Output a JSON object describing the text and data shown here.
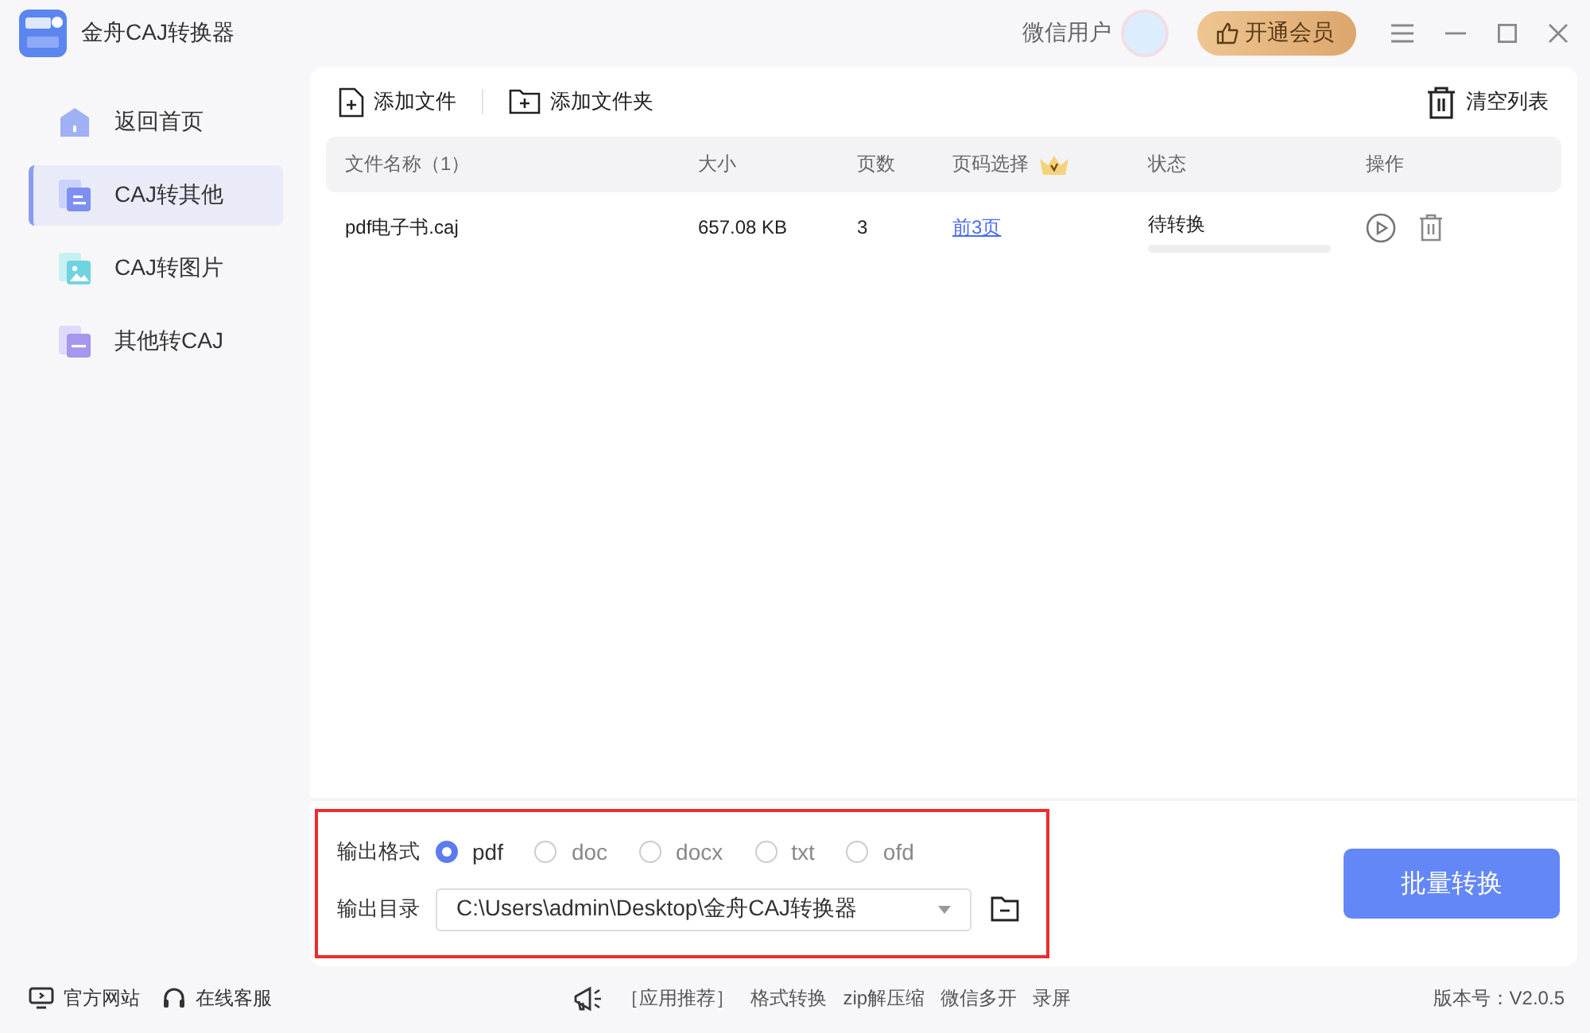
{
  "window": {
    "title": "金舟CAJ转换器"
  },
  "user": {
    "name": "微信用户"
  },
  "vip_button": "开通会员",
  "sidebar": {
    "items": [
      {
        "label": "返回首页",
        "kind": "home",
        "selected": false
      },
      {
        "label": "CAJ转其他",
        "kind": "document",
        "selected": true
      },
      {
        "label": "CAJ转图片",
        "kind": "image",
        "selected": false
      },
      {
        "label": "其他转CAJ",
        "kind": "caj",
        "selected": false
      }
    ]
  },
  "toolbar": {
    "add_file": "添加文件",
    "add_folder": "添加文件夹",
    "clear_list": "清空列表"
  },
  "table": {
    "columns": [
      "文件名称（1）",
      "大小",
      "页数",
      "页码选择",
      "状态",
      "操作"
    ],
    "rows": [
      {
        "name": "pdf电子书.caj",
        "size": "657.08 KB",
        "pages": "3",
        "page_range": "前3页",
        "status": "待转换",
        "level": 0
      }
    ]
  },
  "output": {
    "format_label": "输出格式",
    "formats": [
      {
        "label": "pdf",
        "selected": true
      },
      {
        "label": "doc",
        "selected": false
      },
      {
        "label": "docx",
        "selected": false
      },
      {
        "label": "txt",
        "selected": false
      },
      {
        "label": "ofd",
        "selected": false
      }
    ],
    "dir_label": "输出目录",
    "dir_value": "C:\\Users\\admin\\Desktop\\金舟CAJ转换器"
  },
  "convert_button": "批量转换",
  "status_bar": {
    "links": [
      {
        "label": "官方网站",
        "kind": "monitor"
      },
      {
        "label": "在线客服",
        "kind": "headset"
      }
    ],
    "promo_label": "［应用推荐］",
    "promo_links": [
      "格式转换",
      "zip解压缩",
      "微信多开",
      "录屏"
    ],
    "version": "版本号：V2.0.5"
  }
}
